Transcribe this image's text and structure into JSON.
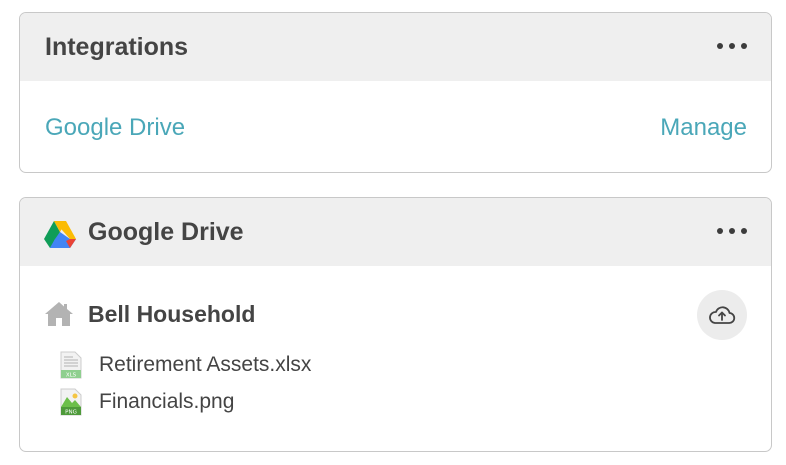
{
  "integrations_card": {
    "title": "Integrations",
    "more_label": "More options",
    "items": [
      {
        "name": "Google Drive",
        "action": "Manage"
      }
    ]
  },
  "drive_card": {
    "title": "Google Drive",
    "icon": "google-drive-icon",
    "more_label": "More options",
    "folder": {
      "icon": "home-icon",
      "name": "Bell Household",
      "upload_icon": "cloud-upload-icon"
    },
    "files": [
      {
        "name": "Retirement Assets.xlsx",
        "type_label": "XLS",
        "icon": "spreadsheet-file-icon"
      },
      {
        "name": "Financials.png",
        "type_label": "PNG",
        "icon": "image-file-icon"
      }
    ]
  },
  "colors": {
    "link": "#4aa7b8",
    "header_bg": "#efefef",
    "border": "#c8c8c8",
    "text": "#444444"
  }
}
